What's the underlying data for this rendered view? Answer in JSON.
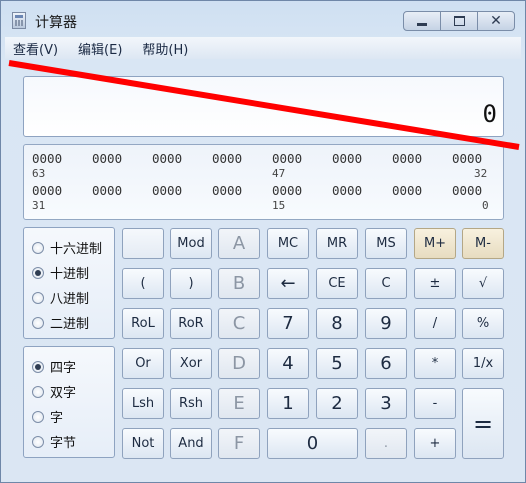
{
  "window": {
    "title": "计算器",
    "icon": "calculator-icon",
    "controls": {
      "minimize": "minimize-icon",
      "maximize": "maximize-icon",
      "close": "close-icon"
    }
  },
  "menu": [
    "查看(V)",
    "编辑(E)",
    "帮助(H)"
  ],
  "display": {
    "value": "0"
  },
  "binary": {
    "row1": [
      "0000",
      "0000",
      "0000",
      "0000",
      "0000",
      "0000",
      "0000",
      "0000"
    ],
    "row1_marks": [
      "63",
      "47",
      "32"
    ],
    "row2": [
      "0000",
      "0000",
      "0000",
      "0000",
      "0000",
      "0000",
      "0000",
      "0000"
    ],
    "row2_marks": [
      "31",
      "15",
      "0"
    ]
  },
  "radix": {
    "options": [
      "十六进制",
      "十进制",
      "八进制",
      "二进制"
    ],
    "selected": "十进制"
  },
  "word_size": {
    "options": [
      "四字",
      "双字",
      "字",
      "字节"
    ],
    "selected": "四字"
  },
  "keys": {
    "row1": [
      "",
      "Mod",
      "A",
      "MC",
      "MR",
      "MS",
      "M+",
      "M-"
    ],
    "row2": [
      "(",
      ")",
      "B",
      "←",
      "CE",
      "C",
      "±",
      "√"
    ],
    "row3": [
      "RoL",
      "RoR",
      "C",
      "7",
      "8",
      "9",
      "/",
      "%"
    ],
    "row4": [
      "Or",
      "Xor",
      "D",
      "4",
      "5",
      "6",
      "*",
      "1/x"
    ],
    "row5": [
      "Lsh",
      "Rsh",
      "E",
      "1",
      "2",
      "3",
      "-",
      "="
    ],
    "row6": [
      "Not",
      "And",
      "F",
      "0",
      ".",
      "+"
    ]
  },
  "colors": {
    "annotation_line": "#ff0000",
    "memory_key": "#efe6ce"
  }
}
